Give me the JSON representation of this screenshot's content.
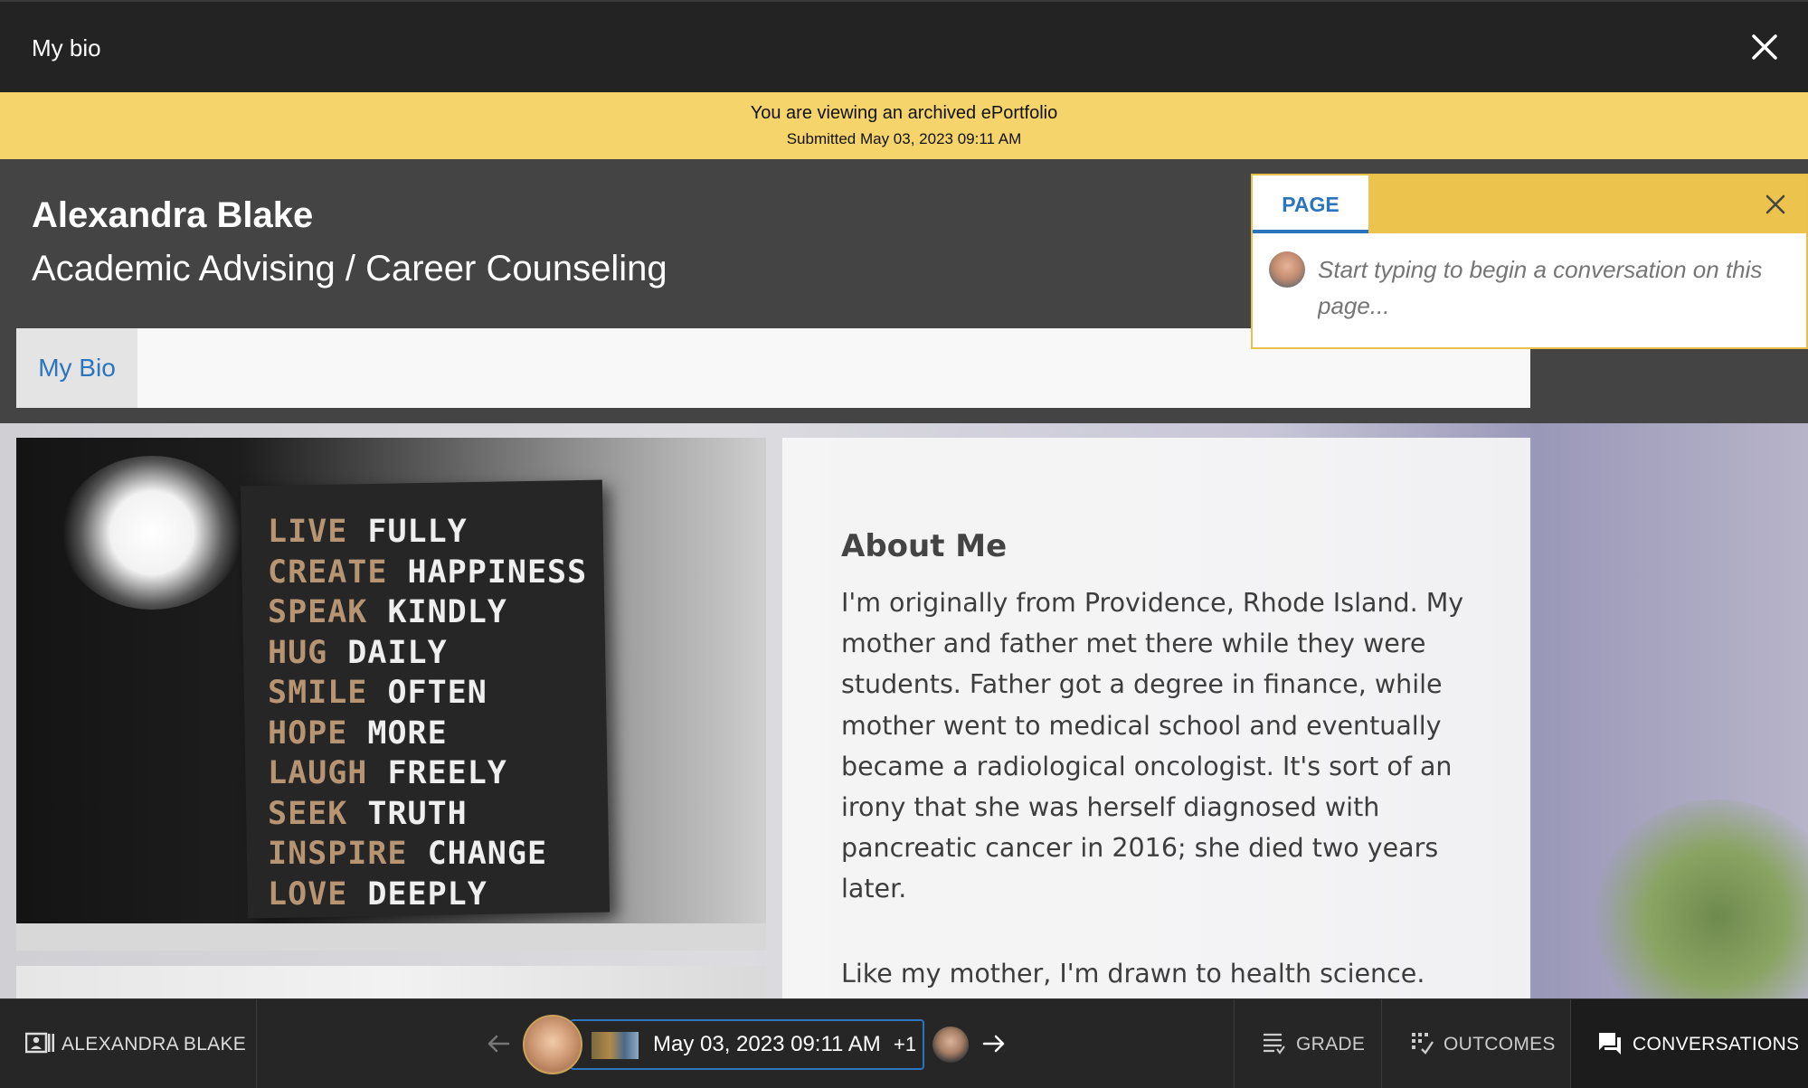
{
  "window": {
    "title": "My bio"
  },
  "banner": {
    "line1": "You are viewing an archived ePortfolio",
    "line2": "Submitted May 03, 2023 09:11 AM"
  },
  "header": {
    "name": "Alexandra Blake",
    "department": "Academic Advising / Career Counseling"
  },
  "nav": {
    "tabs": [
      {
        "label": "My Bio",
        "active": true
      }
    ]
  },
  "poster": {
    "lines": [
      [
        "LIVE",
        "FULLY"
      ],
      [
        "CREATE",
        "HAPPINESS"
      ],
      [
        "SPEAK",
        "KINDLY"
      ],
      [
        "HUG",
        "DAILY"
      ],
      [
        "SMILE",
        "OFTEN"
      ],
      [
        "HOPE",
        "MORE"
      ],
      [
        "LAUGH",
        "FREELY"
      ],
      [
        "SEEK",
        "TRUTH"
      ],
      [
        "INSPIRE",
        "CHANGE"
      ],
      [
        "LOVE",
        "DEEPLY"
      ]
    ]
  },
  "about": {
    "heading": "About Me",
    "paragraph1": "I'm originally from Providence, Rhode Island. My mother and father met there while they were students. Father got a degree in finance, while mother went to medical school and eventually became a radiological oncologist. It's sort of an irony that she was herself diagnosed with pancreatic cancer in 2016; she died two years later.",
    "paragraph2": "Like my mother, I'm drawn to health science."
  },
  "conversation": {
    "tab_label": "PAGE",
    "placeholder": "Start typing to begin a conversation on this page..."
  },
  "bottombar": {
    "user_label": "ALEXANDRA BLAKE",
    "submission_date": "May 03, 2023 09:11 AM",
    "extra_count": "+1",
    "grade_label": "GRADE",
    "outcomes_label": "OUTCOMES",
    "conversations_label": "CONVERSATIONS"
  },
  "colors": {
    "banner": "#f5d46b",
    "link_blue": "#2a74c0",
    "conversation_header": "#ebc34d"
  },
  "icons": {
    "close": "close-icon",
    "user_card": "id-card-icon",
    "prev": "arrow-left-icon",
    "next": "arrow-right-icon",
    "grade": "grade-list-icon",
    "outcomes": "outcomes-grid-icon",
    "conversations": "chat-bubble-icon"
  }
}
